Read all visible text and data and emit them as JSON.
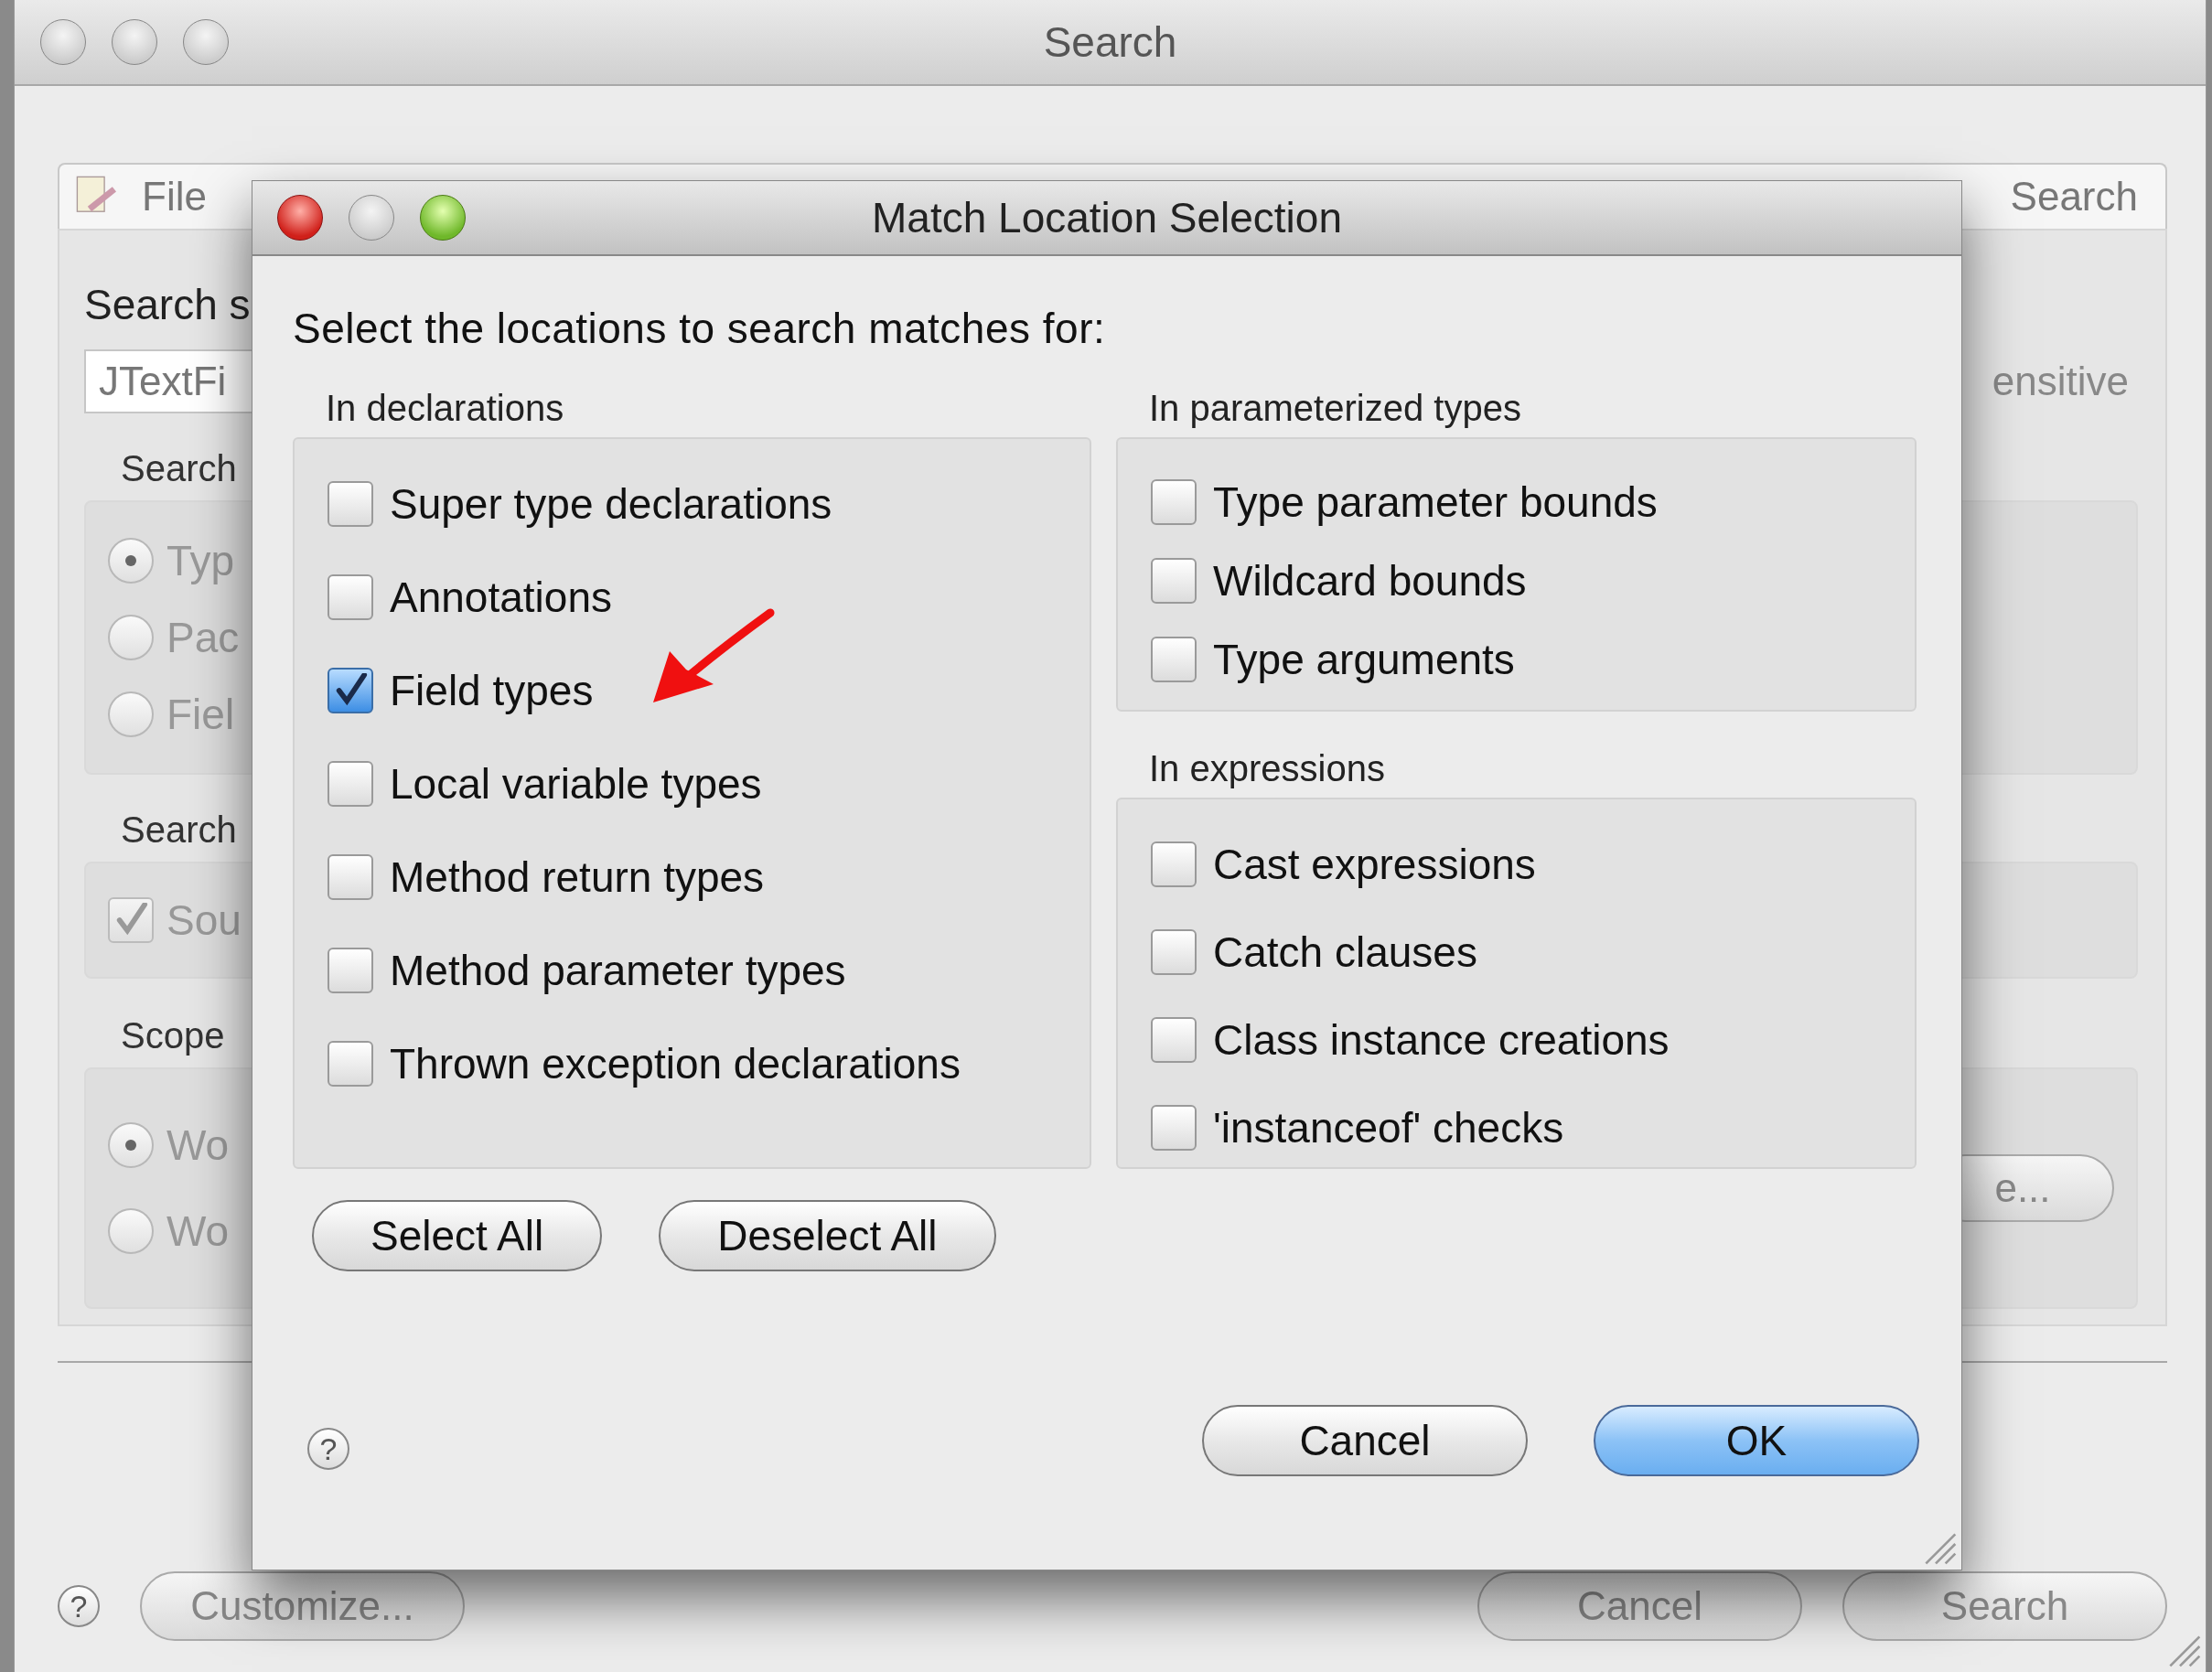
{
  "window": {
    "title": "Search"
  },
  "background_tabs": [
    {
      "label": "File"
    },
    {
      "label": "Search"
    }
  ],
  "background_form": {
    "search_label": "Search s",
    "search_field": "JTextFi",
    "case_option": "ensitive",
    "groups": [
      {
        "label": "Search",
        "kind": "radios",
        "items": [
          {
            "label": "Typ",
            "selected": true
          },
          {
            "label": "Pac",
            "selected": false
          },
          {
            "label": "Fiel",
            "selected": false
          }
        ]
      },
      {
        "label": "Search",
        "kind": "checks",
        "items": [
          {
            "label": "Sou",
            "checked": true
          }
        ]
      },
      {
        "label": "Scope",
        "kind": "radios",
        "items": [
          {
            "label": "Wo",
            "selected": true
          },
          {
            "label": "Wo",
            "selected": false
          }
        ],
        "button": "e..."
      }
    ]
  },
  "background_buttons": {
    "help": "?",
    "left": [
      "Customize..."
    ],
    "right": [
      "Cancel",
      "Search"
    ]
  },
  "dialog": {
    "title": "Match Location Selection",
    "prompt": "Select the locations to search matches for:",
    "columns": [
      {
        "groups": [
          {
            "title": "In declarations",
            "items": [
              {
                "label": "Super type declarations",
                "checked": false
              },
              {
                "label": "Annotations",
                "checked": false
              },
              {
                "label": "Field types",
                "checked": true
              },
              {
                "label": "Local variable types",
                "checked": false
              },
              {
                "label": "Method return types",
                "checked": false
              },
              {
                "label": "Method parameter types",
                "checked": false
              },
              {
                "label": "Thrown exception declarations",
                "checked": false
              }
            ]
          }
        ]
      },
      {
        "groups": [
          {
            "title": "In parameterized types",
            "items": [
              {
                "label": "Type parameter bounds",
                "checked": false
              },
              {
                "label": "Wildcard bounds",
                "checked": false
              },
              {
                "label": "Type arguments",
                "checked": false
              }
            ]
          },
          {
            "title": "In expressions",
            "items": [
              {
                "label": "Cast expressions",
                "checked": false
              },
              {
                "label": "Catch clauses",
                "checked": false
              },
              {
                "label": "Class instance creations",
                "checked": false
              },
              {
                "label": "'instanceof' checks",
                "checked": false
              }
            ]
          }
        ]
      }
    ],
    "help": "?",
    "selection_buttons": [
      "Select All",
      "Deselect All"
    ],
    "buttons": [
      {
        "label": "Cancel",
        "default": false
      },
      {
        "label": "OK",
        "default": true
      }
    ]
  }
}
